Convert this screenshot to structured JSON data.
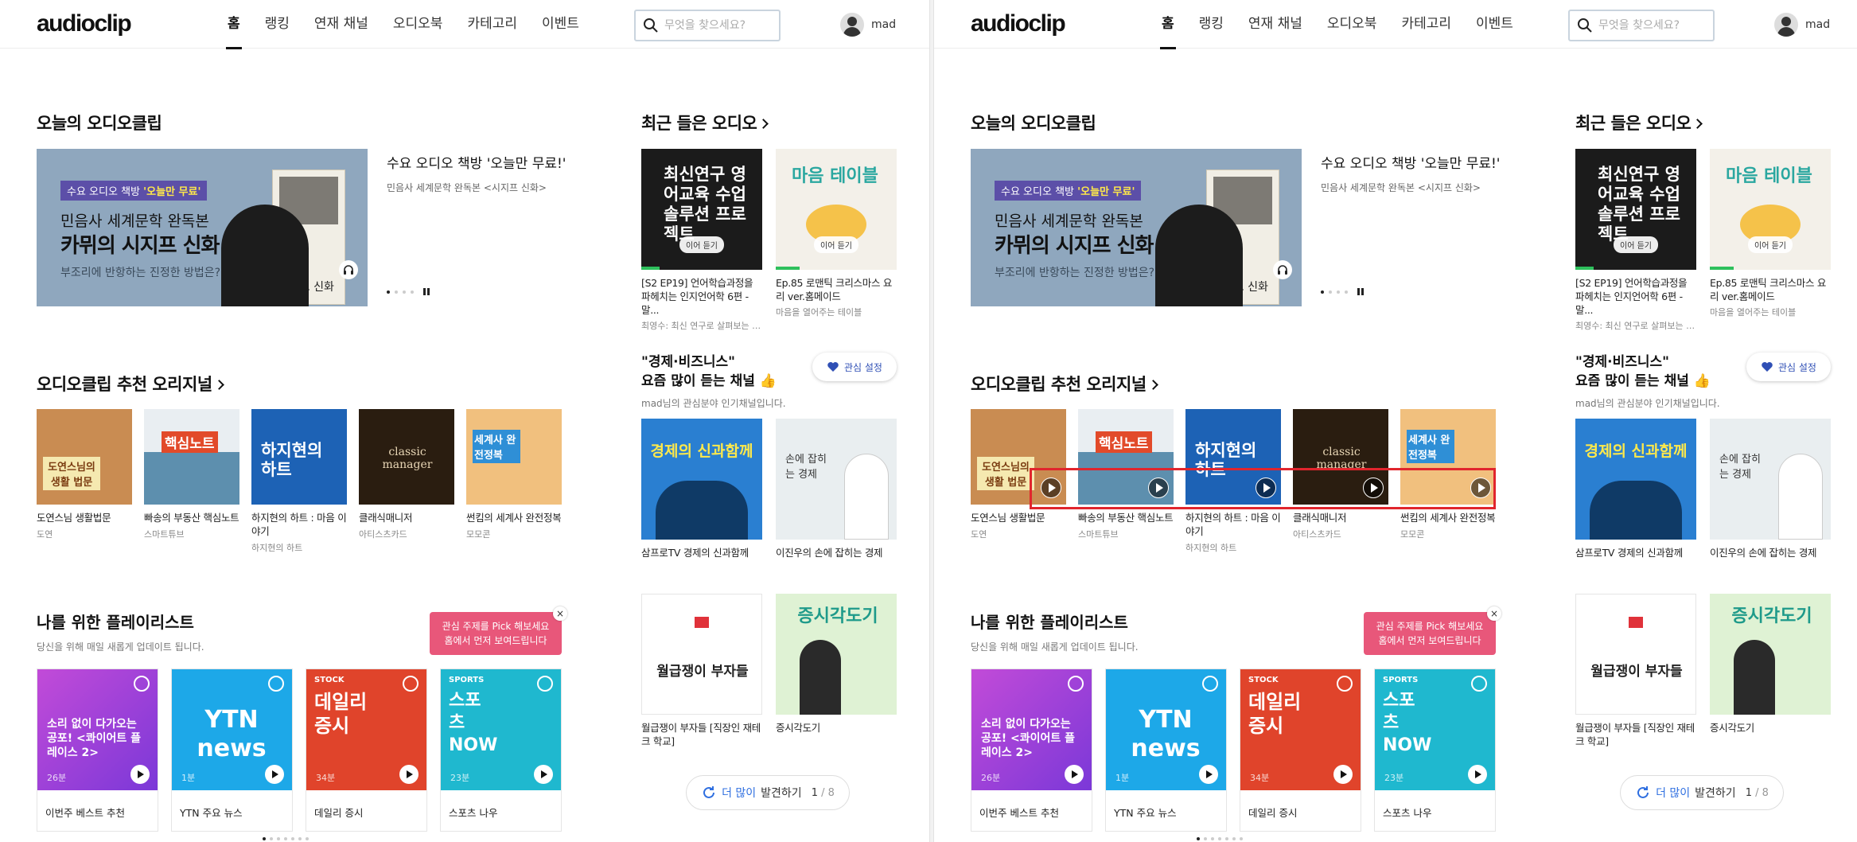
{
  "header": {
    "logo": "audioclip",
    "nav": [
      "홈",
      "랭킹",
      "연재 채널",
      "오디오북",
      "카테고리",
      "이벤트"
    ],
    "search_placeholder": "무엇을 찾으세요?",
    "user_name": "mad"
  },
  "today": {
    "title": "오늘의 오디오클립",
    "banner_tag_prefix": "수요 오디오 책방",
    "banner_tag_highlight": "'오늘만 무료'",
    "banner_line1": "민음사 세계문학 완독본",
    "banner_line2": "카뮈의 시지프 신화",
    "banner_line3": "부조리에 반항하는 진정한 방법은?",
    "book_title": "시지프 신화",
    "feature_title": "수요 오디오 책방 '오늘만 무료!'",
    "feature_sub": "민음사 세계문학 완독본 <시지프 신화>"
  },
  "originals": {
    "title": "오디오클립 추천 오리지널",
    "items": [
      {
        "title": "도연스님 생활법문",
        "sub": "도연",
        "cover_text": "도연스님의 생활 법문",
        "bg": "#c98c52"
      },
      {
        "title": "빠송의 부동산 핵심노트",
        "sub": "스마트튜브",
        "cover_text": "핵심노트",
        "bg": "#5d8fae"
      },
      {
        "title": "하지현의 하트 : 마음 이야기",
        "sub": "하지현의 하트",
        "cover_text": "하지현의 하트",
        "bg": "#1d62b5"
      },
      {
        "title": "클래식매니저",
        "sub": "아티스츠카드",
        "cover_text": "classic manager",
        "bg": "#2a1d10"
      },
      {
        "title": "썬킴의 세계사 완전정복",
        "sub": "모모콘",
        "cover_text": "세계사 완전정복",
        "bg": "#f1c07e"
      }
    ]
  },
  "playlists": {
    "title": "나를 위한 플레이리스트",
    "sub": "당신을 위해 매일 새롭게 업데이트 됩니다.",
    "tooltip_line1": "관심 주제를 Pick 해보세요",
    "tooltip_line2": "홈에서 먼저 보여드립니다",
    "tooltip_close": "×",
    "items": [
      {
        "name": "이번주 베스트 추천",
        "duration": "26분",
        "cover_text": "소리 없이 다가오는 공포! <콰이어트 플레이스 2>",
        "label": "",
        "bg": "#8c3fd6"
      },
      {
        "name": "YTN 주요 뉴스",
        "duration": "1분",
        "cover_text": "YTN news",
        "label": "",
        "bg": "#1da8e8"
      },
      {
        "name": "데일리 증시",
        "duration": "34분",
        "cover_text": "데일리 증시",
        "label": "STOCK",
        "bg": "#e0442b"
      },
      {
        "name": "스포츠 나우",
        "duration": "23분",
        "cover_text": "스포츠 NOW",
        "label": "SPORTS",
        "bg": "#1fb8cf"
      }
    ]
  },
  "recent": {
    "title": "최근 들은 오디오",
    "resume_label": "이어 듣기",
    "items": [
      {
        "title": "[S2 EP19] 언어학습과정을 파헤치는 인지언어학 6편 - 말...",
        "sub": "최영수: 최신 연구로 살펴보는 영어교육",
        "cover_text": "최신연구 영어교육 수업 솔루션 프로젝트",
        "progress": 0.15
      },
      {
        "title": "Ep.85 로맨틱 크리스마스 요리 ver.홈메이드",
        "sub": "마음을 열어주는 테이블",
        "cover_text": "마음 테이블",
        "progress": 0.2
      }
    ]
  },
  "business": {
    "title_line1": "\"경제·비즈니스\"",
    "title_line2": "요즘 많이 듣는 채널",
    "sub": "mad님의 관심분야 인기채널입니다.",
    "interest_btn": "관심 설정",
    "items": [
      {
        "title": "삼프로TV 경제의 신과함께",
        "sub": "",
        "cover_text": "경제의 신과함께",
        "bg": "#2a7fd1"
      },
      {
        "title": "이진우의 손에 잡히는 경제",
        "sub": "",
        "cover_text": "손에 잡히는 경제",
        "bg": "#e9eef0"
      },
      {
        "title": "월급쟁이 부자들 [직장인 재테크 학교]",
        "sub": "",
        "cover_text": "월급쟁이 부자들",
        "bg": "#ffffff"
      },
      {
        "title": "증시각도기",
        "sub": "",
        "cover_text": "증시각도기",
        "bg": "#dff2d4"
      }
    ],
    "more_label_a": "더 많이",
    "more_label_b": "발견하기",
    "more_page": "1",
    "more_total": "/ 8"
  }
}
